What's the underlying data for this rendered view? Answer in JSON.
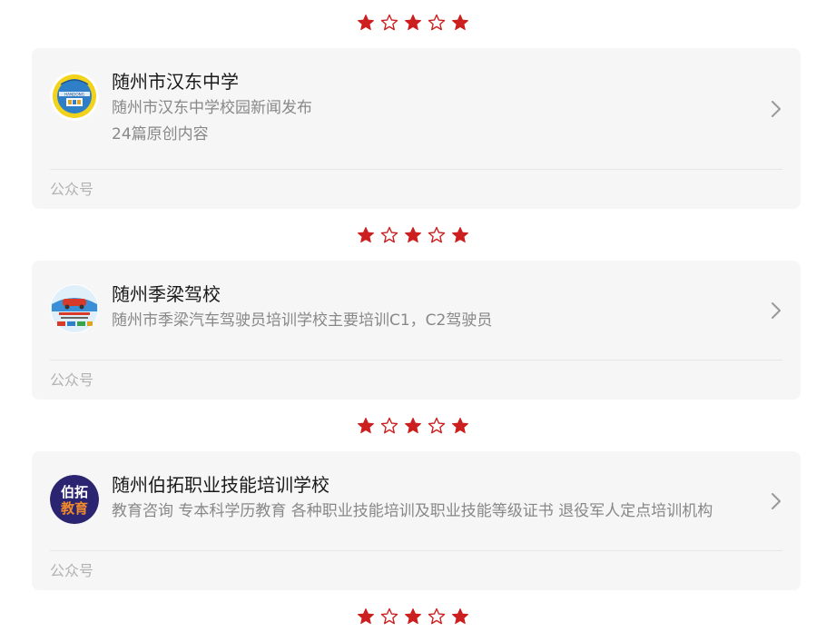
{
  "colors": {
    "star_red": "#cc1f1f",
    "card_bg": "#f6f6f6",
    "title_text": "#1a1a1a",
    "secondary_text": "#888888",
    "label_text": "#b2b2b2"
  },
  "star_rows": [
    [
      "filled",
      "outline",
      "filled",
      "outline",
      "filled"
    ],
    [
      "filled",
      "outline",
      "filled",
      "outline",
      "filled"
    ],
    [
      "filled",
      "outline",
      "filled",
      "outline",
      "filled"
    ],
    [
      "filled",
      "outline",
      "filled",
      "outline",
      "filled"
    ]
  ],
  "cards": [
    {
      "name": "随州市汉东中学",
      "description": "随州市汉东中学校园新闻发布",
      "article_count": "24篇原创内容",
      "type_label": "公众号",
      "avatar_icon": "hangdong-school-logo-icon"
    },
    {
      "name": "随州季梁驾校",
      "description": "随州市季梁汽车驾驶员培训学校主要培训C1，C2驾驶员",
      "type_label": "公众号",
      "avatar_icon": "driving-school-logo-icon"
    },
    {
      "name": "随州伯拓职业技能培训学校",
      "description": "教育咨询 专本科学历教育 各种职业技能培训及职业技能等级证书 退役军人定点培训机构",
      "type_label": "公众号",
      "avatar_icon": "bota-education-logo-icon",
      "avatar_text": [
        "伯拓",
        "教育"
      ]
    }
  ]
}
